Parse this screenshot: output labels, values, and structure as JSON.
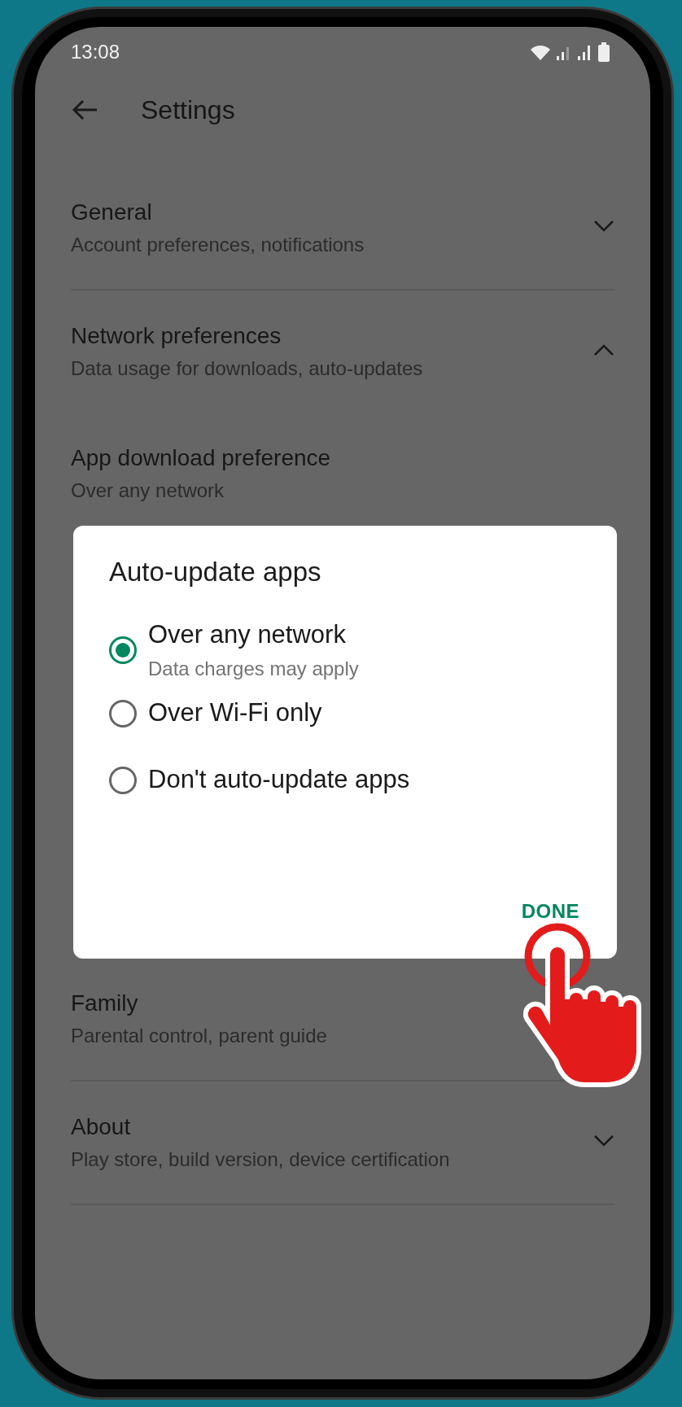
{
  "status_bar": {
    "time": "13:08"
  },
  "header": {
    "title": "Settings"
  },
  "sections": [
    {
      "title": "General",
      "subtitle": "Account preferences, notifications",
      "expanded": false
    },
    {
      "title": "Network preferences",
      "subtitle": "Data usage for downloads, auto-updates",
      "expanded": true,
      "children": [
        {
          "title": "App download preference",
          "subtitle": "Over any network"
        }
      ]
    },
    {
      "title": "Family",
      "subtitle": "Parental control, parent guide"
    },
    {
      "title": "About",
      "subtitle": "Play store, build version, device certification",
      "expanded": false
    }
  ],
  "dialog": {
    "title": "Auto-update apps",
    "options": [
      {
        "label": "Over any network",
        "description": "Data charges may apply",
        "selected": true
      },
      {
        "label": "Over Wi-Fi only",
        "selected": false
      },
      {
        "label": "Don't auto-update apps",
        "selected": false
      }
    ],
    "button": "DONE"
  }
}
